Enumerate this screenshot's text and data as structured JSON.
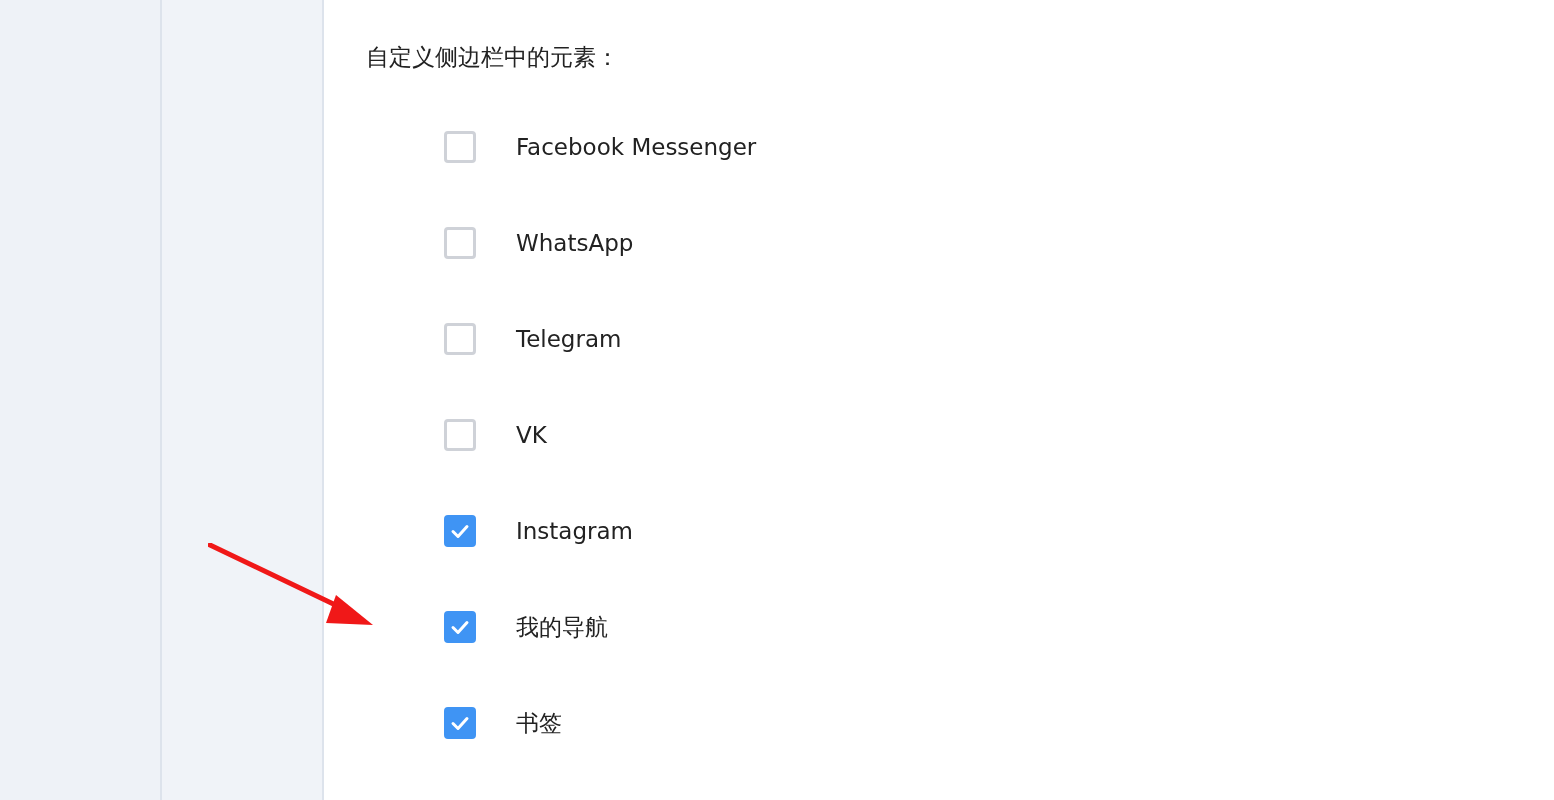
{
  "heading": "自定义侧边栏中的元素：",
  "items": [
    {
      "label": "Facebook Messenger",
      "checked": false
    },
    {
      "label": "WhatsApp",
      "checked": false
    },
    {
      "label": "Telegram",
      "checked": false
    },
    {
      "label": "VK",
      "checked": false
    },
    {
      "label": "Instagram",
      "checked": true
    },
    {
      "label": "我的导航",
      "checked": true
    },
    {
      "label": "书签",
      "checked": true
    }
  ]
}
